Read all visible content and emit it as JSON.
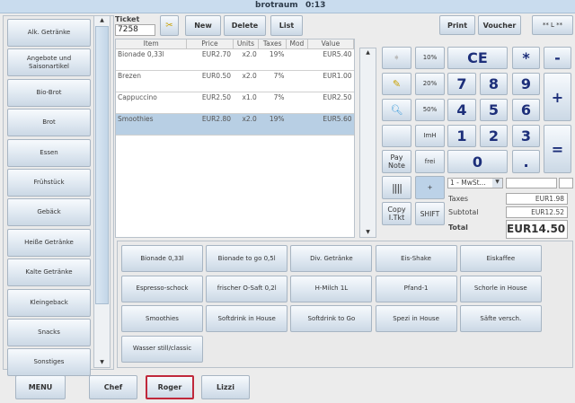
{
  "title": {
    "app": "brotraum",
    "time": "0:13"
  },
  "categories": [
    "Alk. Getränke",
    "Angebote und Saisonartikel",
    "Bio-Brot",
    "Brot",
    "Essen",
    "Frühstück",
    "Gebäck",
    "Heiße Getränke",
    "Kalte Getränke",
    "Kleingeback",
    "Snacks",
    "Sonstiges"
  ],
  "ticket": {
    "label": "Ticket",
    "number": "7258",
    "new": "New",
    "delete": "Delete",
    "list": "List"
  },
  "top_buttons": {
    "print": "Print",
    "voucher": "Voucher",
    "layout": "** L **"
  },
  "table": {
    "headers": [
      "Item",
      "Price",
      "Units",
      "Taxes",
      "Mod",
      "Value"
    ],
    "rows": [
      [
        "Bionade 0,33l",
        "EUR2.70",
        "x2.0",
        "19%",
        "",
        "EUR5.40"
      ],
      [
        "Brezen",
        "EUR0.50",
        "x2.0",
        "7%",
        "",
        "EUR1.00"
      ],
      [
        "Cappuccino",
        "EUR2.50",
        "x1.0",
        "7%",
        "",
        "EUR2.50"
      ],
      [
        "Smoothies",
        "EUR2.80",
        "x2.0",
        "19%",
        "",
        "EUR5.60"
      ]
    ],
    "selected_row": 3
  },
  "keypad": {
    "p10": "10%",
    "p20": "20%",
    "p50": "50%",
    "imh": "ImH",
    "frei": "frei",
    "pay_note": "Pay Note",
    "copy": "Copy I.Tkt",
    "shift": "SHIFT",
    "plus_small": "+",
    "ce": "CE",
    "mul": "*",
    "minus": "-",
    "plus": "+",
    "eq": "=",
    "dot": ".",
    "d7": "7",
    "d8": "8",
    "d9": "9",
    "d4": "4",
    "d5": "5",
    "d6": "6",
    "d1": "1",
    "d2": "2",
    "d3": "3",
    "d0": "0"
  },
  "tax_select": "1 - MwSt...",
  "totals": {
    "taxes_label": "Taxes",
    "taxes": "EUR1.98",
    "subtotal_label": "Subtotal",
    "subtotal": "EUR12.52",
    "total_label": "Total",
    "total": "EUR14.50"
  },
  "products": [
    "Bionade 0,33l",
    "Bionade to go 0,5l",
    "Div. Getränke",
    "Eis-Shake",
    "Eiskaffee",
    "Espresso-schock",
    "frischer O-Saft 0,2l",
    "H-Milch 1L",
    "Pfand-1",
    "Schorle in House",
    "Smoothies",
    "Softdrink in House",
    "Softdrink to Go",
    "Spezi in House",
    "Säfte versch.",
    "Wasser still/classic"
  ],
  "bottom": {
    "menu": "MENU",
    "users": [
      "Chef",
      "Roger",
      "Lizzi"
    ],
    "active_user": "Roger"
  },
  "colors": {
    "selection": "#b8cfe4",
    "active_user_border": "#c0283a",
    "key_text": "#1d2f7a"
  }
}
